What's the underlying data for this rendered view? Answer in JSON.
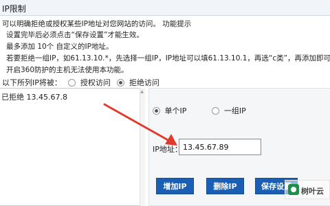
{
  "window": {
    "title": "IP限制"
  },
  "notice": {
    "lines": [
      "可以明确拒绝或授权某些IP地址对您网站的访问。 功能提示",
      "设置完毕后必须点击“保存设置”才能生效。",
      "最多添加 10个 自定义的IP地址。",
      "若要拒绝一组IP，如61.13.10.*，先选择一组IP，IP地址可以填61.13.10.1，再选“c类”，再添加即可。",
      "开启360防护的主机无法使用本功能。"
    ]
  },
  "mode": {
    "prefix": "以下所列IP将被：",
    "options": [
      {
        "label": "授权访问",
        "checked": false
      },
      {
        "label": "拒绝访问",
        "checked": true
      }
    ]
  },
  "ip_list": {
    "items": [
      "已拒绝 13.45.67.8"
    ]
  },
  "ip_type": {
    "options": [
      {
        "label": "单个IP",
        "checked": true
      },
      {
        "label": "一组IP",
        "checked": false
      }
    ]
  },
  "ip_field": {
    "label": "IP地址：",
    "value": "13.45.67.89"
  },
  "buttons": {
    "add": "增加IP",
    "delete": "删除IP",
    "save": "保存设置"
  },
  "watermark": {
    "text": "树叶云"
  },
  "colors": {
    "button_bg": "#1a5fb4",
    "arrow": "#e03a2f",
    "titlebar_bg": "#f1f5fa"
  }
}
